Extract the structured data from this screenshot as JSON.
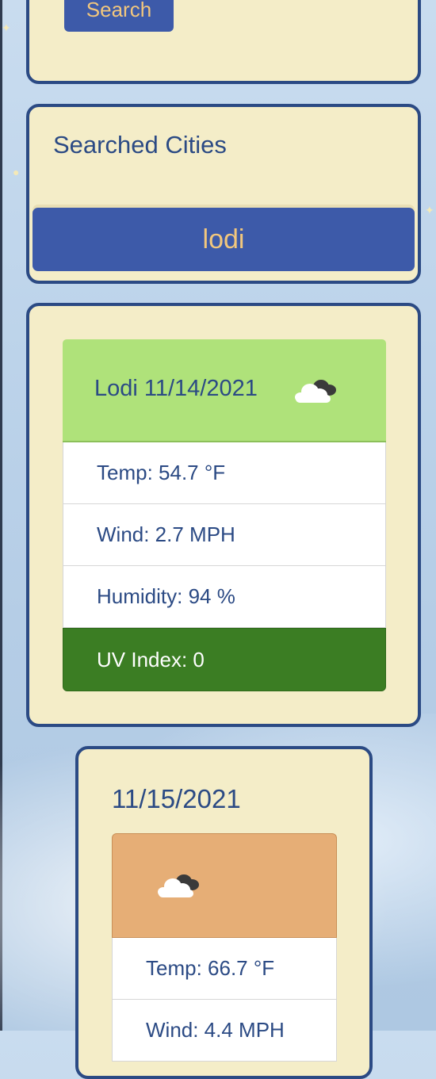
{
  "search": {
    "button_label": "Search"
  },
  "history": {
    "title": "Searched Cities",
    "cities": [
      "lodi"
    ]
  },
  "current": {
    "title": "Lodi 11/14/2021",
    "icon": "cloudy-icon",
    "temp": "Temp: 54.7 °F",
    "wind": "Wind: 2.7 MPH",
    "humidity": "Humidity: 94 %",
    "uv": "UV Index: 0",
    "colors": {
      "header": "#afe27a",
      "uv_badge": "#3b7d23"
    }
  },
  "forecast": [
    {
      "date": "11/15/2021",
      "icon": "cloudy-icon",
      "temp": "Temp: 66.7 °F",
      "wind": "Wind: 4.4 MPH",
      "colors": {
        "header": "#e6ae76"
      }
    }
  ],
  "theme": {
    "card_bg": "#f4edc8",
    "card_border": "#2b4a84",
    "accent": "#3d5aa9",
    "accent_text": "#f2c77d"
  }
}
